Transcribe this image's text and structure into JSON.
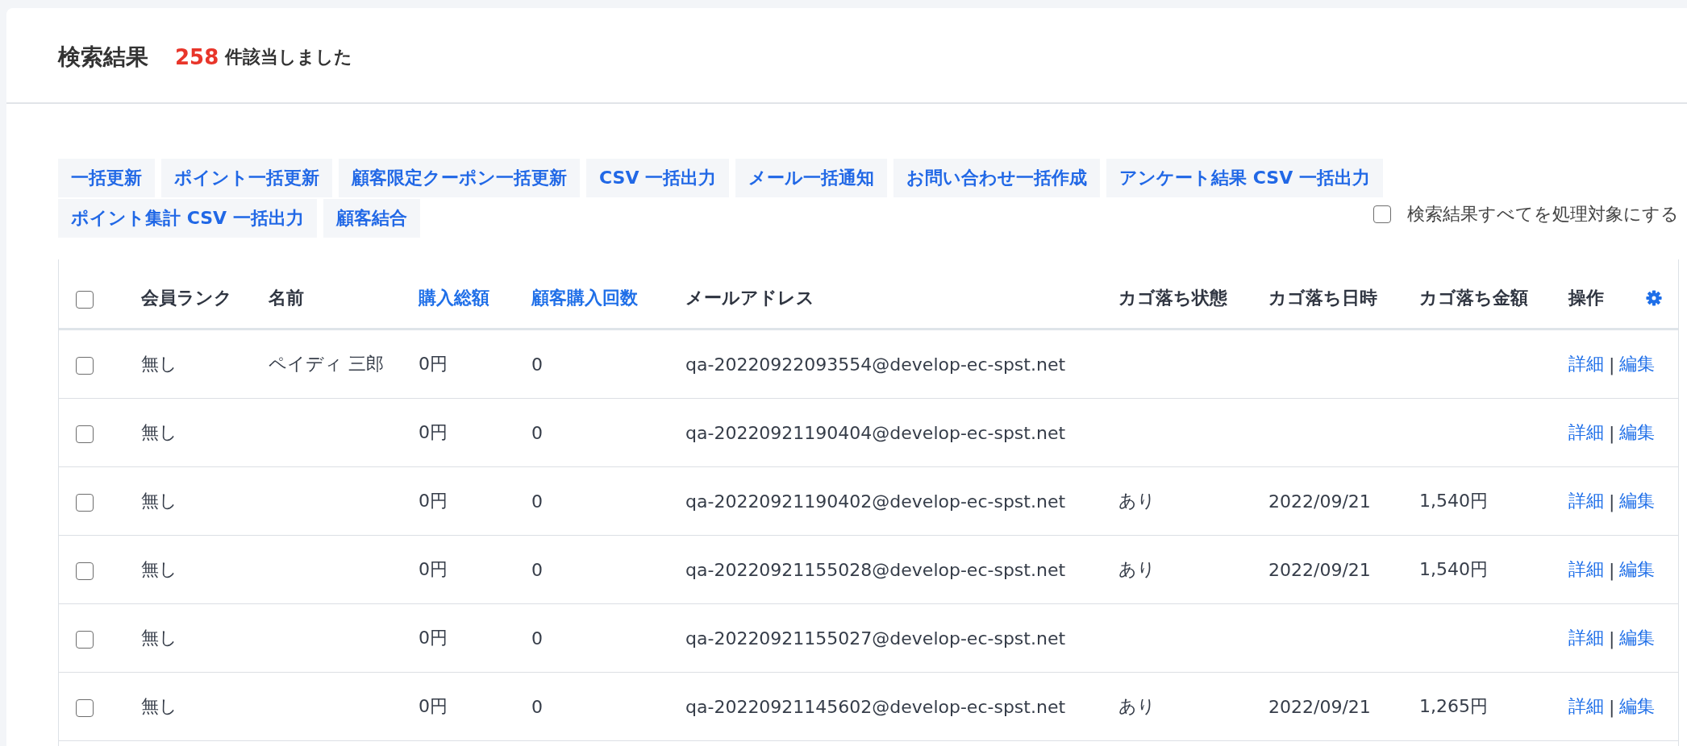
{
  "header": {
    "title": "検索結果",
    "count": "258",
    "count_label": "件該当しました"
  },
  "bulk_actions": [
    {
      "label": "一括更新"
    },
    {
      "label": "ポイント一括更新"
    },
    {
      "label": "顧客限定クーポン一括更新"
    },
    {
      "label": "CSV 一括出力"
    },
    {
      "label": "メール一括通知"
    },
    {
      "label": "お問い合わせ一括作成"
    },
    {
      "label": "アンケート結果 CSV 一括出力"
    },
    {
      "label": "ポイント集計 CSV 一括出力"
    },
    {
      "label": "顧客結合"
    }
  ],
  "select_all": {
    "label": "検索結果すべてを処理対象にする",
    "checked": false
  },
  "table": {
    "header_checked": false,
    "columns": [
      {
        "label": "会員ランク",
        "sortable": false
      },
      {
        "label": "名前",
        "sortable": false
      },
      {
        "label": "購入総額",
        "sortable": true
      },
      {
        "label": "顧客購入回数",
        "sortable": true
      },
      {
        "label": "メールアドレス",
        "sortable": false
      },
      {
        "label": "カゴ落ち状態",
        "sortable": false
      },
      {
        "label": "カゴ落ち日時",
        "sortable": false
      },
      {
        "label": "カゴ落ち金額",
        "sortable": false
      },
      {
        "label": "操作",
        "sortable": false
      }
    ],
    "rows": [
      {
        "checked": false,
        "rank": "無し",
        "name": "ペイディ 三郎",
        "total": "0円",
        "count": "0",
        "email": "qa-20220922093554@develop-ec-spst.net",
        "actions": {
          "detail": "詳細",
          "separator": "|",
          "edit": "編集"
        }
      },
      {
        "checked": false,
        "rank": "無し",
        "total": "0円",
        "count": "0",
        "email": "qa-20220921190404@develop-ec-spst.net",
        "actions": {
          "detail": "詳細",
          "separator": "|",
          "edit": "編集"
        }
      },
      {
        "checked": false,
        "rank": "無し",
        "total": "0円",
        "count": "0",
        "email": "qa-20220921190402@develop-ec-spst.net",
        "cart_status": "あり",
        "cart_date": "2022/09/21",
        "cart_amount": "1,540円",
        "actions": {
          "detail": "詳細",
          "separator": "|",
          "edit": "編集"
        }
      },
      {
        "checked": false,
        "rank": "無し",
        "total": "0円",
        "count": "0",
        "email": "qa-20220921155028@develop-ec-spst.net",
        "cart_status": "あり",
        "cart_date": "2022/09/21",
        "cart_amount": "1,540円",
        "actions": {
          "detail": "詳細",
          "separator": "|",
          "edit": "編集"
        }
      },
      {
        "checked": false,
        "rank": "無し",
        "total": "0円",
        "count": "0",
        "email": "qa-20220921155027@develop-ec-spst.net",
        "actions": {
          "detail": "詳細",
          "separator": "|",
          "edit": "編集"
        }
      },
      {
        "checked": false,
        "rank": "無し",
        "total": "0円",
        "count": "0",
        "email": "qa-20220921145602@develop-ec-spst.net",
        "cart_status": "あり",
        "cart_date": "2022/09/21",
        "cart_amount": "1,265円",
        "actions": {
          "detail": "詳細",
          "separator": "|",
          "edit": "編集"
        }
      }
    ]
  }
}
